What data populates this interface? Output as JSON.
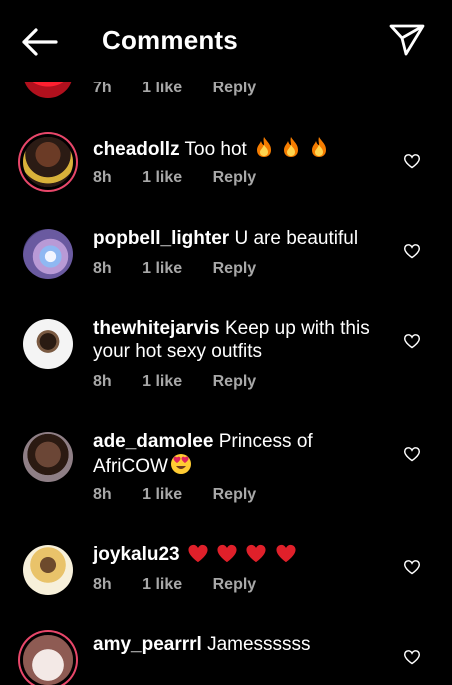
{
  "header": {
    "title": "Comments",
    "back_icon": "arrow-left-icon",
    "send_icon": "paper-plane-icon"
  },
  "top_partial": {
    "time": "7h",
    "likes": "1 like",
    "reply": "Reply"
  },
  "comments": [
    {
      "username": "cheadollz",
      "text": "Too hot",
      "emojis": [
        "fire",
        "fire",
        "fire"
      ],
      "time": "8h",
      "likes": "1 like",
      "reply": "Reply"
    },
    {
      "username": "popbell_lighter",
      "text": "U are beautiful",
      "time": "8h",
      "likes": "1 like",
      "reply": "Reply"
    },
    {
      "username": "thewhitejarvis",
      "text": "Keep up with this your hot sexy outfits",
      "line2": "your hot sexy outfits",
      "line1": "Keep up with this",
      "time": "8h",
      "likes": "1 like",
      "reply": "Reply"
    },
    {
      "username": "ade_damolee",
      "text_line1": "Princess of",
      "text_line2": "AfriCOW",
      "emojis": [
        "heart-eyes"
      ],
      "time": "8h",
      "likes": "1 like",
      "reply": "Reply"
    },
    {
      "username": "joykalu23",
      "text": "",
      "emojis": [
        "red-heart",
        "red-heart",
        "red-heart",
        "red-heart"
      ],
      "time": "8h",
      "likes": "1 like",
      "reply": "Reply"
    },
    {
      "username": "amy_pearrrl",
      "text": "Jamessssss"
    }
  ],
  "colors": {
    "background": "#000000",
    "meta": "#a8a8a8",
    "ring": "#e8476a"
  }
}
